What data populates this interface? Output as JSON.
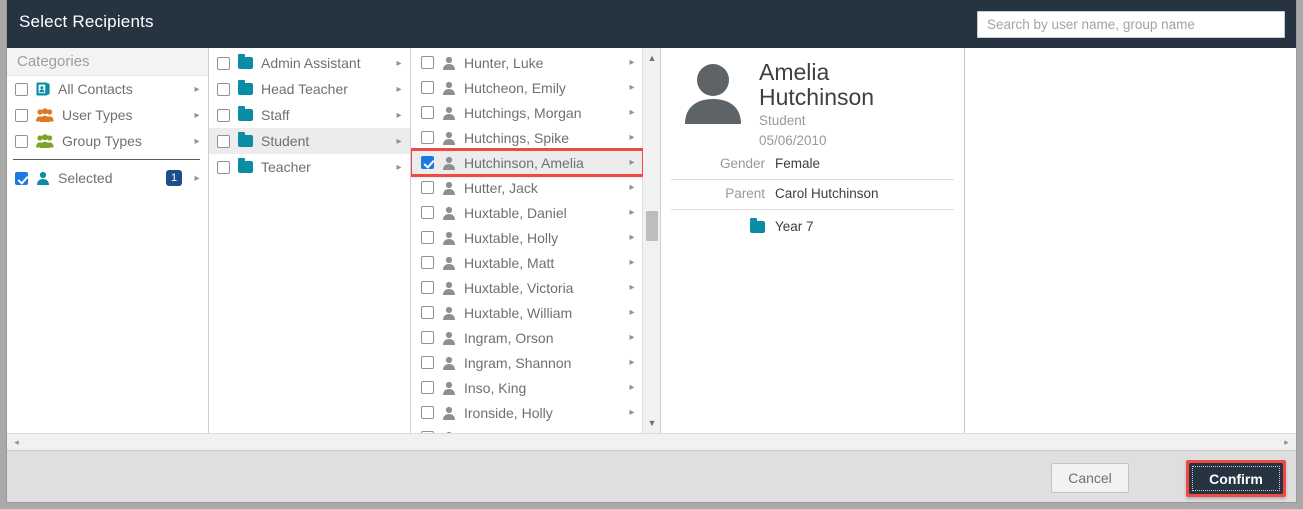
{
  "window": {
    "title": "Select Recipients"
  },
  "search": {
    "placeholder": "Search by user name, group name",
    "value": ""
  },
  "categories": {
    "header": "Categories",
    "items": [
      {
        "label": "All Contacts",
        "icon": "address-book-icon",
        "checked": false,
        "caret": "▸",
        "badge": ""
      },
      {
        "label": "User Types",
        "icon": "users-orange-icon",
        "checked": false,
        "caret": "▸",
        "badge": ""
      },
      {
        "label": "Group Types",
        "icon": "users-green-icon",
        "checked": false,
        "caret": "▸",
        "badge": ""
      },
      {
        "label": "Selected",
        "icon": "person-teal-icon",
        "checked": true,
        "caret": "▸",
        "badge": "1"
      }
    ]
  },
  "folders": {
    "items": [
      {
        "label": "Admin Assistant",
        "icon": "folder-icon",
        "checked": false,
        "caret": "▸",
        "highlight": false
      },
      {
        "label": "Head Teacher",
        "icon": "folder-icon",
        "checked": false,
        "caret": "▸",
        "highlight": false
      },
      {
        "label": "Staff",
        "icon": "folder-icon",
        "checked": false,
        "caret": "▸",
        "highlight": false
      },
      {
        "label": "Student",
        "icon": "folder-icon",
        "checked": false,
        "caret": "▸",
        "highlight": true
      },
      {
        "label": "Teacher",
        "icon": "folder-icon",
        "checked": false,
        "caret": "▸",
        "highlight": false
      }
    ]
  },
  "people": {
    "items": [
      {
        "label": "Hunter, Luke",
        "icon": "person-icon",
        "checked": false,
        "caret": "▸",
        "selected": false
      },
      {
        "label": "Hutcheon, Emily",
        "icon": "person-icon",
        "checked": false,
        "caret": "▸",
        "selected": false
      },
      {
        "label": "Hutchings, Morgan",
        "icon": "person-icon",
        "checked": false,
        "caret": "▸",
        "selected": false
      },
      {
        "label": "Hutchings, Spike",
        "icon": "person-icon",
        "checked": false,
        "caret": "▸",
        "selected": false
      },
      {
        "label": "Hutchinson, Amelia",
        "icon": "person-icon",
        "checked": true,
        "caret": "▸",
        "selected": true
      },
      {
        "label": "Hutter, Jack",
        "icon": "person-icon",
        "checked": false,
        "caret": "▸",
        "selected": false
      },
      {
        "label": "Huxtable, Daniel",
        "icon": "person-icon",
        "checked": false,
        "caret": "▸",
        "selected": false
      },
      {
        "label": "Huxtable, Holly",
        "icon": "person-icon",
        "checked": false,
        "caret": "▸",
        "selected": false
      },
      {
        "label": "Huxtable, Matt",
        "icon": "person-icon",
        "checked": false,
        "caret": "▸",
        "selected": false
      },
      {
        "label": "Huxtable, Victoria",
        "icon": "person-icon",
        "checked": false,
        "caret": "▸",
        "selected": false
      },
      {
        "label": "Huxtable, William",
        "icon": "person-icon",
        "checked": false,
        "caret": "▸",
        "selected": false
      },
      {
        "label": "Ingram, Orson",
        "icon": "person-icon",
        "checked": false,
        "caret": "▸",
        "selected": false
      },
      {
        "label": "Ingram, Shannon",
        "icon": "person-icon",
        "checked": false,
        "caret": "▸",
        "selected": false
      },
      {
        "label": "Inso, King",
        "icon": "person-icon",
        "checked": false,
        "caret": "▸",
        "selected": false
      },
      {
        "label": "Ironside, Holly",
        "icon": "person-icon",
        "checked": false,
        "caret": "▸",
        "selected": false
      },
      {
        "label": "",
        "icon": "person-icon",
        "checked": false,
        "caret": "▸",
        "selected": false
      }
    ],
    "scroll_up_arrow": "▲",
    "scroll_down_arrow": "▼"
  },
  "detail": {
    "first_name": "Amelia",
    "last_name": "Hutchinson",
    "role": "Student",
    "date_of_birth": "05/06/2010",
    "fields": [
      {
        "key": "Gender",
        "value": "Female"
      },
      {
        "key": "Parent",
        "value": "Carol Hutchinson"
      }
    ],
    "group": {
      "icon": "folder-icon",
      "label": "Year 7"
    }
  },
  "hscroll": {
    "left_arrow": "◂",
    "right_arrow": "▸"
  },
  "footer": {
    "cancel_label": "Cancel",
    "confirm_label": "Confirm"
  },
  "colors": {
    "header_bg": "#263340",
    "accent_teal": "#0a8ca6",
    "highlight_red": "#f04a43",
    "checkbox_blue": "#1a7ae0",
    "badge_blue": "#1d4e89",
    "orange": "#e0761f",
    "green": "#7ba428"
  }
}
